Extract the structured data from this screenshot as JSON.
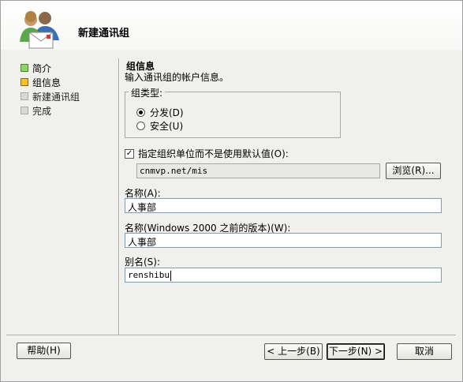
{
  "header": {
    "title": "新建通讯组"
  },
  "steps": [
    {
      "label": "简介",
      "state": "done"
    },
    {
      "label": "组信息",
      "state": "current"
    },
    {
      "label": "新建通讯组",
      "state": "pending"
    },
    {
      "label": "完成",
      "state": "pending"
    }
  ],
  "section": {
    "title": "组信息",
    "description": "输入通讯组的帐户信息。"
  },
  "group_type": {
    "legend": "组类型:",
    "options": [
      {
        "label": "分发(D)",
        "checked": true
      },
      {
        "label": "安全(U)",
        "checked": false
      }
    ]
  },
  "ou": {
    "checkbox_label": "指定组织单位而不是使用默认值(O):",
    "checkbox_mark": "✓",
    "value": "cnmvp.net/mis",
    "browse_label": "浏览(R)..."
  },
  "fields": {
    "name_label": "名称(A):",
    "name_value": "人事部",
    "prewin_label": "名称(Windows 2000 之前的版本)(W):",
    "prewin_value": "人事部",
    "alias_label": "别名(S):",
    "alias_value": "renshibu"
  },
  "buttons": {
    "help": "帮助(H)",
    "back": "< 上一步(B)",
    "next": "下一步(N) >",
    "cancel": "取消"
  },
  "colors": {
    "step_done": "#8fd16a",
    "step_current": "#f4c430",
    "step_pending": "#d8d8d8"
  }
}
